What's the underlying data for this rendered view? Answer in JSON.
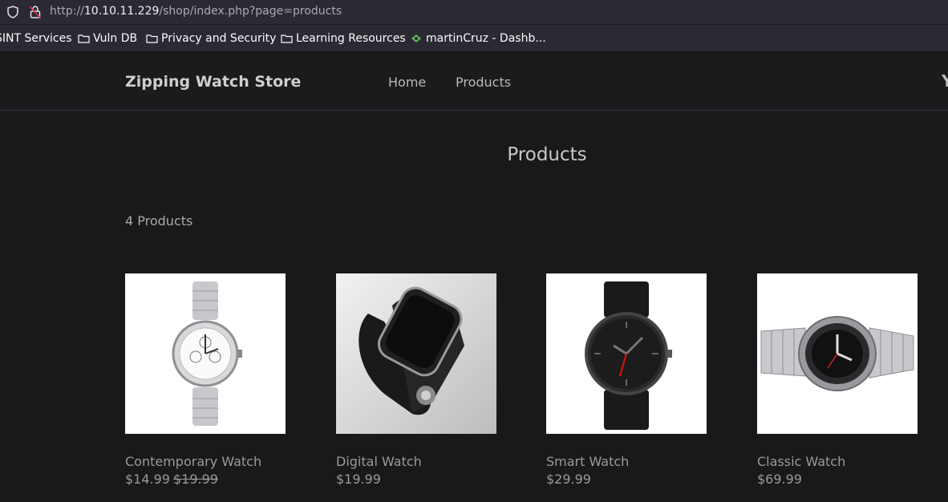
{
  "browser": {
    "url_prefix": "http://",
    "url_host": "10.10.11.229",
    "url_path": "/shop/index.php?page=products"
  },
  "bookmarks": [
    {
      "label": "SINT Services",
      "icon": "none"
    },
    {
      "label": "Vuln DB",
      "icon": "folder-icon"
    },
    {
      "label": "Privacy and Security",
      "icon": "folder-icon"
    },
    {
      "label": "Learning Resources",
      "icon": "folder-icon"
    },
    {
      "label": "martinCruz - Dashb...",
      "icon": "favicon"
    }
  ],
  "header": {
    "brand": "Zipping Watch Store",
    "nav": [
      "Home",
      "Products"
    ]
  },
  "main": {
    "title": "Products",
    "count": "4 Products",
    "products": [
      {
        "name": "Contemporary Watch",
        "price": "$14.99",
        "old_price": "$19.99"
      },
      {
        "name": "Digital Watch",
        "price": "$19.99"
      },
      {
        "name": "Smart Watch",
        "price": "$29.99"
      },
      {
        "name": "Classic Watch",
        "price": "$69.99"
      }
    ]
  }
}
